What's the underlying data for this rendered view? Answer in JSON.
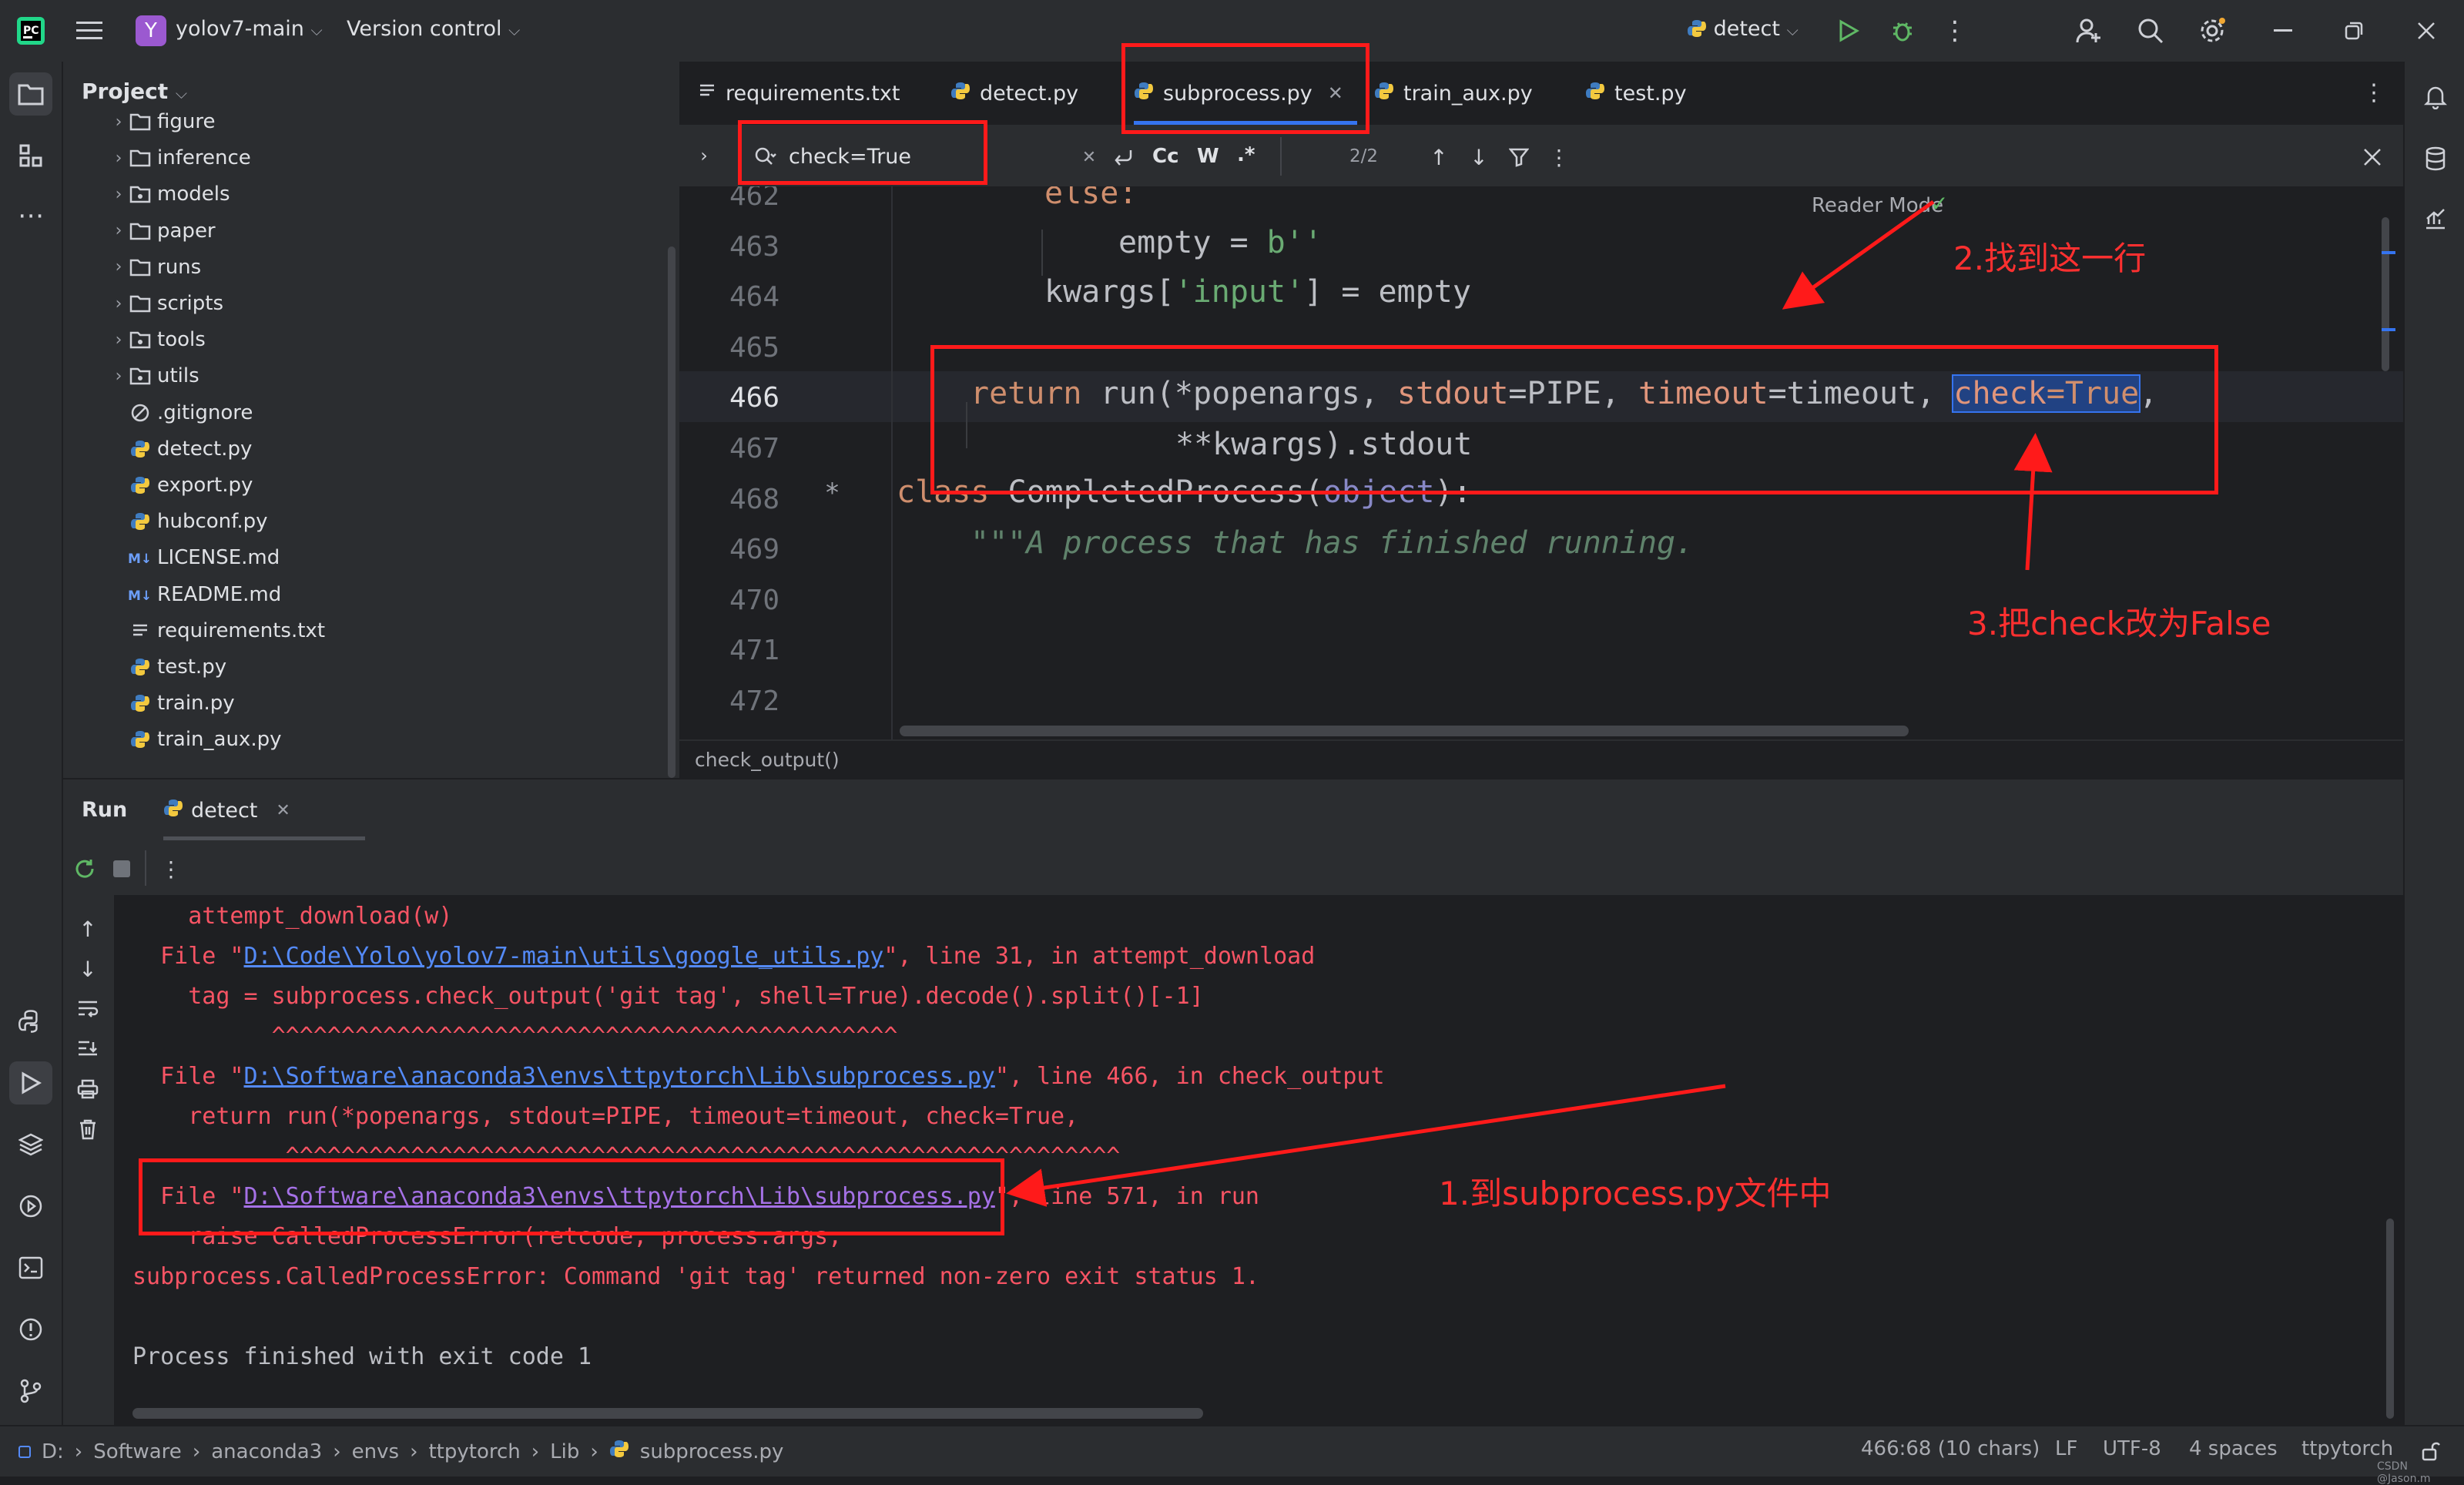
{
  "titlebar": {
    "project_badge": "Y",
    "project_name": "yolov7-main",
    "vcs": "Version control",
    "run_config": "detect"
  },
  "project_panel": {
    "title": "Project",
    "items": [
      {
        "label": "figure",
        "kind": "folder"
      },
      {
        "label": "inference",
        "kind": "folder"
      },
      {
        "label": "models",
        "kind": "package"
      },
      {
        "label": "paper",
        "kind": "folder"
      },
      {
        "label": "runs",
        "kind": "folder"
      },
      {
        "label": "scripts",
        "kind": "folder"
      },
      {
        "label": "tools",
        "kind": "package"
      },
      {
        "label": "utils",
        "kind": "package"
      },
      {
        "label": ".gitignore",
        "kind": "ignore"
      },
      {
        "label": "detect.py",
        "kind": "python"
      },
      {
        "label": "export.py",
        "kind": "python"
      },
      {
        "label": "hubconf.py",
        "kind": "python"
      },
      {
        "label": "LICENSE.md",
        "kind": "markdown"
      },
      {
        "label": "README.md",
        "kind": "markdown"
      },
      {
        "label": "requirements.txt",
        "kind": "text"
      },
      {
        "label": "test.py",
        "kind": "python"
      },
      {
        "label": "train.py",
        "kind": "python"
      },
      {
        "label": "train_aux.py",
        "kind": "python"
      }
    ]
  },
  "tabs": [
    {
      "label": "requirements.txt",
      "kind": "text"
    },
    {
      "label": "detect.py",
      "kind": "python"
    },
    {
      "label": "subprocess.py",
      "kind": "python",
      "active": true
    },
    {
      "label": "train_aux.py",
      "kind": "python"
    },
    {
      "label": "test.py",
      "kind": "python"
    }
  ],
  "find": {
    "query": "check=True",
    "opt_case": "Cc",
    "opt_word": "W",
    "opt_regex": ".*",
    "count": "2/2"
  },
  "editor": {
    "reader_mode": "Reader Mode",
    "line_numbers": [
      "462",
      "463",
      "464",
      "465",
      "466",
      "467",
      "468",
      "469",
      "470",
      "471",
      "472"
    ],
    "l462": "else:",
    "l463_a": "empty = ",
    "l463_b": "b''",
    "l464_a": "kwargs[",
    "l464_b": "'input'",
    "l464_c": "] = empty",
    "l466_a": "return",
    "l466_b": " run(*popenargs, ",
    "l466_c": "stdout",
    "l466_d": "=PIPE, ",
    "l466_e": "timeout",
    "l466_f": "=timeout, ",
    "l466_g": "check",
    "l466_h": "=True",
    "l466_i": ",",
    "l467": "**kwargs).stdout",
    "l470_a": "class",
    "l470_b": " CompletedProcess(",
    "l470_c": "object",
    "l470_d": "):",
    "l470_marker": "*",
    "l471": "\"\"\"A process that has finished running.",
    "breadcrumb": "check_output()"
  },
  "run": {
    "tab_run": "Run",
    "tab_config": "detect",
    "lines": {
      "c1": "    attempt_download(w)",
      "c2_a": "  File \"",
      "c2_link": "D:\\Code\\Yolo\\yolov7-main\\utils\\google_utils.py",
      "c2_b": "\", line 31, in attempt_download",
      "c3": "    tag = subprocess.check_output('git tag', shell=True).decode().split()[-1]",
      "c4": "          ^^^^^^^^^^^^^^^^^^^^^^^^^^^^^^^^^^^^^^^^^^^^^",
      "c5_a": "  File \"",
      "c5_link": "D:\\Software\\anaconda3\\envs\\ttpytorch\\Lib\\subprocess.py",
      "c5_b": "\", line 466, in check_output",
      "c6": "    return run(*popenargs, stdout=PIPE, timeout=timeout, check=True,",
      "c7": "           ^^^^^^^^^^^^^^^^^^^^^^^^^^^^^^^^^^^^^^^^^^^^^^^^^^^^^^^^^^^^",
      "c8_a": "  File \"",
      "c8_link": "D:\\Software\\anaconda3\\envs\\ttpytorch\\Lib\\subprocess.py",
      "c8_b": "\", line 571, in run",
      "c9": "    raise CalledProcessError(retcode, process.args,",
      "c10": "subprocess.CalledProcessError: Command 'git tag' returned non-zero exit status 1.",
      "c11": "Process finished with exit code 1"
    }
  },
  "statusbar": {
    "path": [
      "D:",
      "Software",
      "anaconda3",
      "envs",
      "ttpytorch",
      "Lib",
      "subprocess.py"
    ],
    "position": "466:68 (10 chars)",
    "line_sep": "LF",
    "encoding": "UTF-8",
    "indent": "4 spaces",
    "interpreter": "ttpytorch",
    "watermark": "CSDN @Jason.m"
  },
  "annotations": {
    "a1": "1.到subprocess.py文件中",
    "a2": "2.找到这一行",
    "a3": "3.把check改为False"
  },
  "colors": {
    "accent": "#3574f0",
    "annotation": "#ff1a1a"
  }
}
